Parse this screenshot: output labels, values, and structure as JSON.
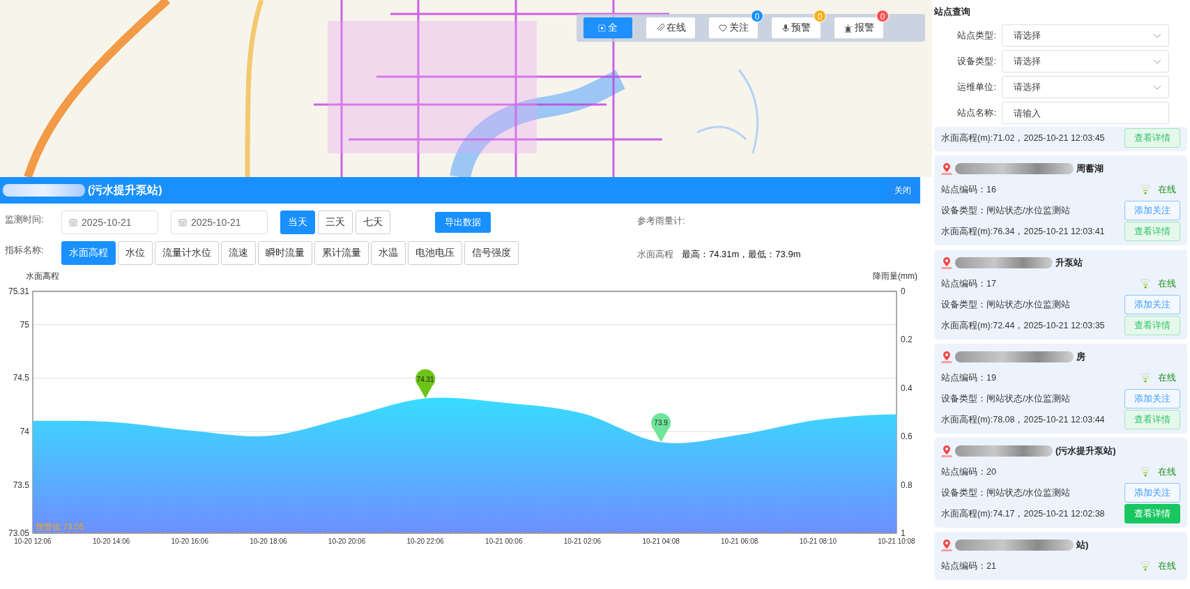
{
  "map": {
    "toolbar": [
      {
        "label": "全",
        "selected": true
      },
      {
        "label": "在线",
        "selected": false
      },
      {
        "label": "关注",
        "selected": false,
        "badge": "0",
        "color": "#1890ff"
      },
      {
        "label": "预警",
        "selected": false,
        "badge": "0",
        "color": "#faad14"
      },
      {
        "label": "报警",
        "selected": false,
        "badge": "0",
        "color": "#ff4d4f"
      }
    ]
  },
  "detail": {
    "title": "(污水提升泵站)",
    "close": "关闭",
    "time_label": "监测时间:",
    "start_date": "2025-10-21",
    "end_date": "2025-10-21",
    "ranges": [
      {
        "label": "当天",
        "selected": true
      },
      {
        "label": "三天",
        "selected": false
      },
      {
        "label": "七天",
        "selected": false
      }
    ],
    "export": "导出数据",
    "rain_gauge_label": "参考雨量计:",
    "indicator_label": "指标名称:",
    "indicators": [
      {
        "label": "水面高程",
        "selected": true
      },
      {
        "label": "水位",
        "selected": false
      },
      {
        "label": "流量计水位",
        "selected": false
      },
      {
        "label": "流速",
        "selected": false
      },
      {
        "label": "瞬时流量",
        "selected": false
      },
      {
        "label": "累计流量",
        "selected": false
      },
      {
        "label": "水温",
        "selected": false
      },
      {
        "label": "电池电压",
        "selected": false
      },
      {
        "label": "信号强度",
        "selected": false
      }
    ],
    "stats": {
      "name": "水面高程",
      "text": "最高：74.31m，最低：73.9m"
    },
    "rain_axis": {
      "label": "降雨量(mm)",
      "ticks": [
        "0",
        "0.2",
        "0.4",
        "0.6",
        "0.8",
        "1"
      ]
    },
    "chart_data": {
      "type": "area",
      "ylabel": "水面高程",
      "categories": [
        "10-20 12:06",
        "10-20 14:06",
        "10-20 16:06",
        "10-20 18:06",
        "10-20 20:06",
        "10-20 22:06",
        "10-21 00:06",
        "10-21 02:06",
        "10-21 04:08",
        "10-21 06:08",
        "10-21 08:10",
        "10-21 10:08"
      ],
      "series": [
        {
          "values": [
            74.1,
            74.09,
            74.01,
            73.96,
            74.13,
            74.31,
            74.27,
            74.17,
            73.9,
            73.97,
            74.11,
            74.16
          ]
        }
      ],
      "grid": true,
      "ylim": [
        73.05,
        75.31
      ],
      "yticks": [
        73.05,
        73.5,
        74,
        74.5,
        75,
        75.31
      ],
      "annotations": [
        {
          "text": "74.31",
          "x": "10-20 22:06",
          "y": 74.31
        },
        {
          "text": "73.9",
          "x": "10-21 04:08",
          "y": 73.9
        },
        {
          "text": "预警值:73.05",
          "y": 73.05
        }
      ]
    }
  },
  "query": {
    "title": "站点查询",
    "fields": [
      {
        "kind": "select",
        "label": "站点类型:",
        "placeholder": "请选择"
      },
      {
        "kind": "select",
        "label": "设备类型:",
        "placeholder": "请选择"
      },
      {
        "kind": "select",
        "label": "运维单位:",
        "placeholder": "请选择"
      },
      {
        "kind": "input",
        "label": "站点名称:",
        "placeholder": "请输入"
      }
    ]
  },
  "stations": [
    {
      "kind": "partial",
      "reading": "水面高程(m):71.02，2025-10-21 12:03:45",
      "detail_button": "查看详情",
      "detail_active": false
    },
    {
      "kind": "full",
      "name": "周蓄湖",
      "code": "站点编码：16",
      "status": "在线",
      "device": "设备类型：闸站状态/水位监测站",
      "follow_button": "添加关注",
      "reading": "水面高程(m):76.34，2025-10-21 12:03:41",
      "detail_button": "查看详情",
      "detail_active": false
    },
    {
      "kind": "full",
      "name": "升泵站",
      "code": "站点编码：17",
      "status": "在线",
      "device": "设备类型：闸站状态/水位监测站",
      "follow_button": "添加关注",
      "reading": "水面高程(m):72.44，2025-10-21 12:03:35",
      "detail_button": "查看详情",
      "detail_active": false
    },
    {
      "kind": "full",
      "name": "房",
      "code": "站点编码：19",
      "status": "在线",
      "device": "设备类型：闸站状态/水位监测站",
      "follow_button": "添加关注",
      "reading": "水面高程(m):78.08，2025-10-21 12:03:44",
      "detail_button": "查看详情",
      "detail_active": false
    },
    {
      "kind": "full",
      "name": "(污水提升泵站)",
      "code": "站点编码：20",
      "status": "在线",
      "device": "设备类型：闸站状态/水位监测站",
      "follow_button": "添加关注",
      "reading": "水面高程(m):74.17，2025-10-21 12:02:38",
      "detail_button": "查看详情",
      "detail_active": true
    },
    {
      "kind": "top",
      "name": "站)",
      "code": "站点编码：21",
      "status": "在线"
    }
  ]
}
